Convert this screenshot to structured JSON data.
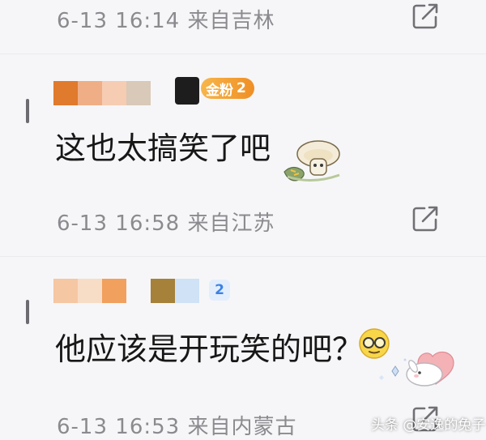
{
  "comments": [
    {
      "time_location": "6-13 16:14 来自吉林"
    },
    {
      "badge_label": "金粉",
      "badge_level": "2",
      "text": "这也太搞笑了吧",
      "time_location": "6-13 16:58 来自江苏"
    },
    {
      "badge_level": "2",
      "text": "他应该是开玩笑的吧？",
      "time_location": "6-13 16:53 来自内蒙古"
    }
  ],
  "watermark": "头条 @安逸的兔子",
  "icons": {
    "share": "share-icon",
    "sticker_mushroom": "mushroom-sticker",
    "emoji_glasses": "glasses-emoji",
    "sticker_bunny": "bunny-heart-sticker"
  },
  "colors": {
    "meta_text": "#8b8b8f",
    "body_text": "#171717",
    "badge_gold": "#f0a030",
    "level_blue": "#3c82e6"
  }
}
